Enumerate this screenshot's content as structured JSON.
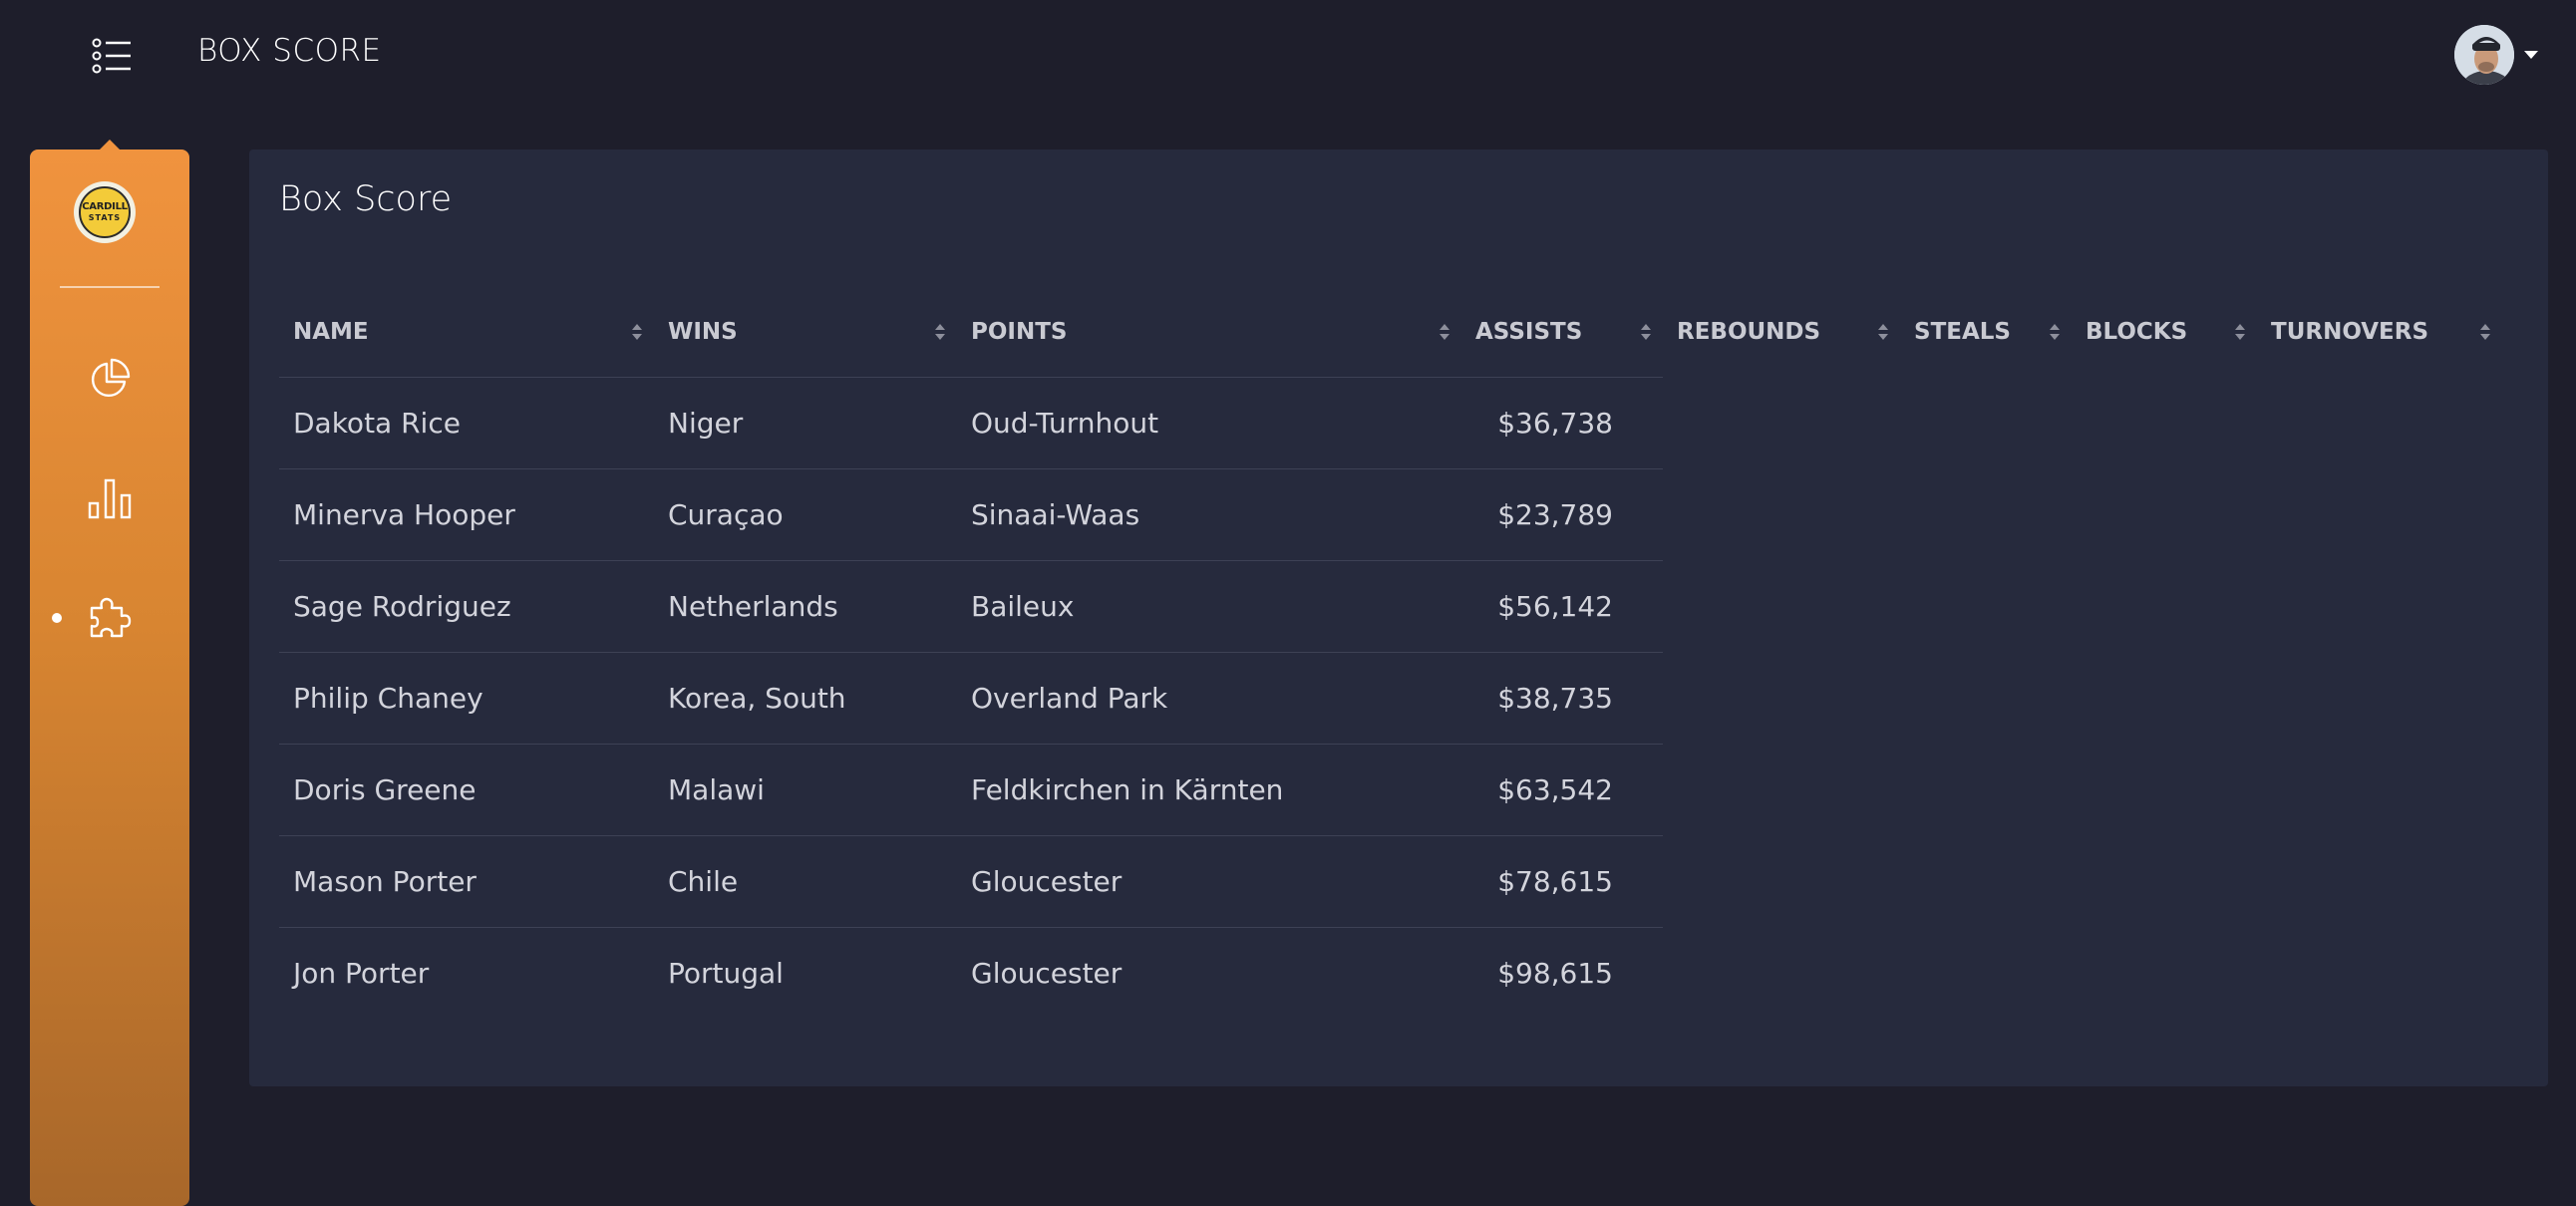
{
  "navbar": {
    "title": "BOX SCORE",
    "menu_icon": "list-bullets-icon",
    "avatar_alt": "user avatar"
  },
  "sidebar": {
    "logo": {
      "line1": "CARDILL",
      "line2": "STATS"
    },
    "items": [
      {
        "icon": "pie-chart-icon",
        "active": false
      },
      {
        "icon": "bar-chart-icon",
        "active": false
      },
      {
        "icon": "puzzle-piece-icon",
        "active": true
      }
    ],
    "accent_color": "#f0933e"
  },
  "card": {
    "title": "Box Score"
  },
  "table": {
    "columns": [
      "NAME",
      "WINS",
      "POINTS",
      "ASSISTS",
      "REBOUNDS",
      "STEALS",
      "BLOCKS",
      "TURNOVERS"
    ],
    "rows": [
      [
        "Dakota Rice",
        "Niger",
        "Oud-Turnhout",
        "$36,738"
      ],
      [
        "Minerva Hooper",
        "Curaçao",
        "Sinaai-Waas",
        "$23,789"
      ],
      [
        "Sage Rodriguez",
        "Netherlands",
        "Baileux",
        "$56,142"
      ],
      [
        "Philip Chaney",
        "Korea, South",
        "Overland Park",
        "$38,735"
      ],
      [
        "Doris Greene",
        "Malawi",
        "Feldkirchen in Kärnten",
        "$63,542"
      ],
      [
        "Mason Porter",
        "Chile",
        "Gloucester",
        "$78,615"
      ],
      [
        "Jon Porter",
        "Portugal",
        "Gloucester",
        "$98,615"
      ]
    ]
  }
}
